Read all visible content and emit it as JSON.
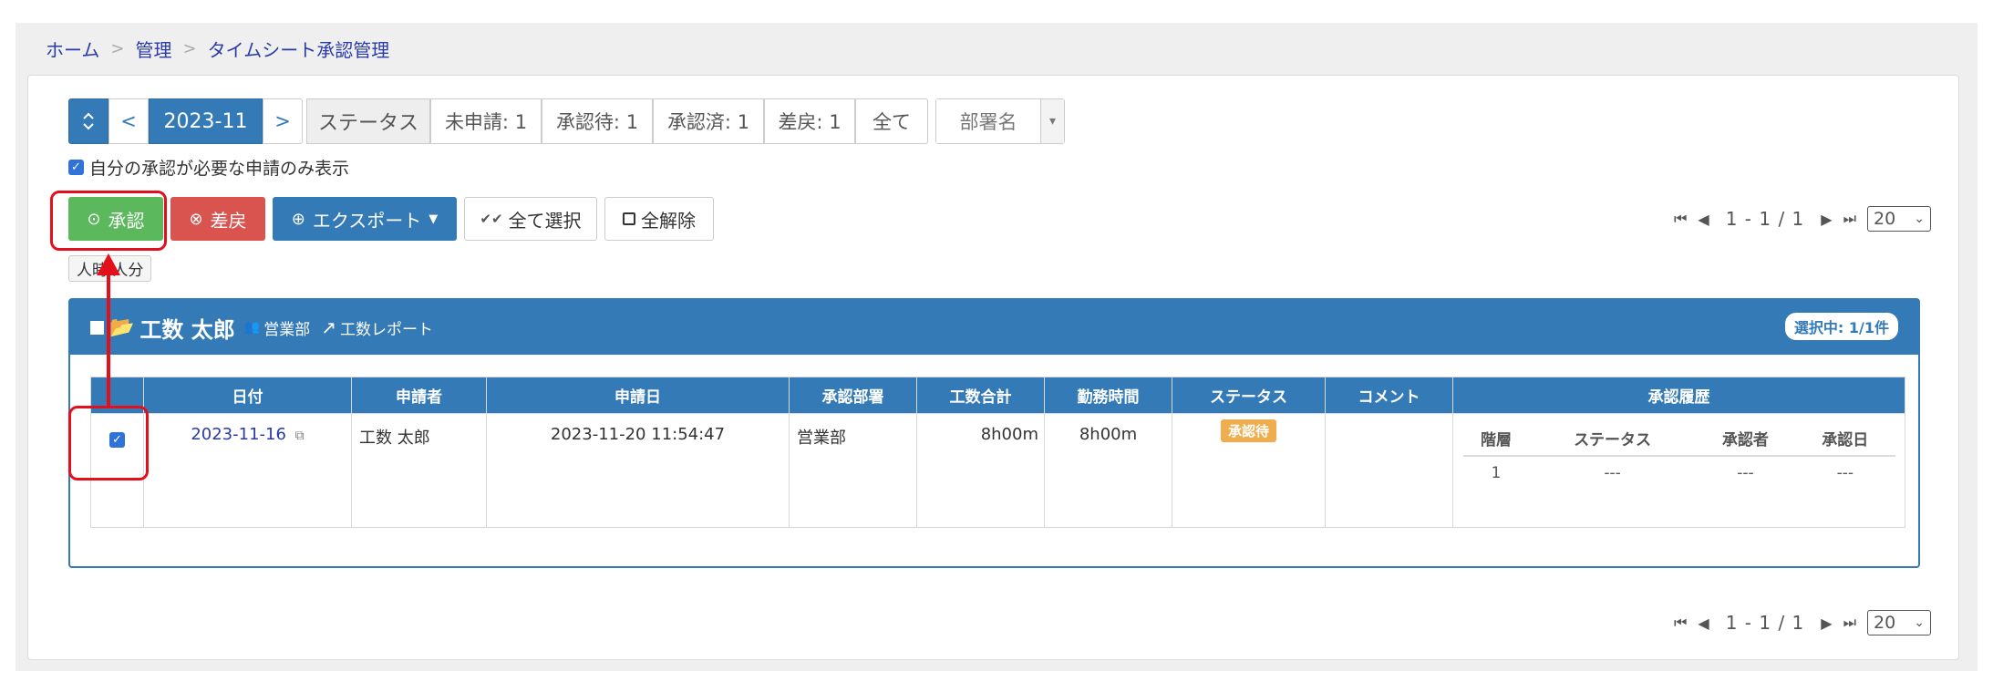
{
  "breadcrumb": {
    "home": "ホーム",
    "admin": "管理",
    "current": "タイムシート承認管理",
    "separator": ">"
  },
  "toolbar": {
    "sort_icon": "updown-icon",
    "prev": "<",
    "month": "2023-11",
    "next": ">",
    "status_label": "ステータス",
    "filters": [
      "未申請: 1",
      "承認待: 1",
      "承認済: 1",
      "差戻: 1",
      "全て"
    ],
    "department_placeholder": "部署名",
    "department_caret": "▾"
  },
  "only_mine_label": "自分の承認が必要な申請のみ表示",
  "actions": {
    "approve": "承認",
    "reject": "差戻",
    "export": "エクスポート",
    "select_all": "全て選択",
    "deselect_all": "全解除"
  },
  "pager": {
    "range": "1 - 1 / 1",
    "per_page": "20"
  },
  "count_tag": "人時 人分",
  "user": {
    "name": "工数 太郎",
    "department": "営業部",
    "report_link": "工数レポート",
    "selected_badge": "選択中: 1/1件"
  },
  "table": {
    "headers": [
      "",
      "日付",
      "申請者",
      "申請日",
      "承認部署",
      "工数合計",
      "勤務時間",
      "ステータス",
      "コメント",
      "承認履歴"
    ],
    "row": {
      "date": "2023-11-16",
      "applicant": "工数 太郎",
      "applied_at": "2023-11-20 11:54:47",
      "department": "営業部",
      "total": "8h00m",
      "work_time": "8h00m",
      "status": "承認待",
      "comment": ""
    },
    "history_headers": [
      "階層",
      "ステータス",
      "承認者",
      "承認日"
    ],
    "history_row": [
      "1",
      "---",
      "---",
      "---"
    ]
  },
  "colors": {
    "primary": "#337ab7",
    "approve": "#5cb85c",
    "reject": "#d9534f",
    "pending": "#f0ad4e",
    "highlight": "#e3101b"
  }
}
